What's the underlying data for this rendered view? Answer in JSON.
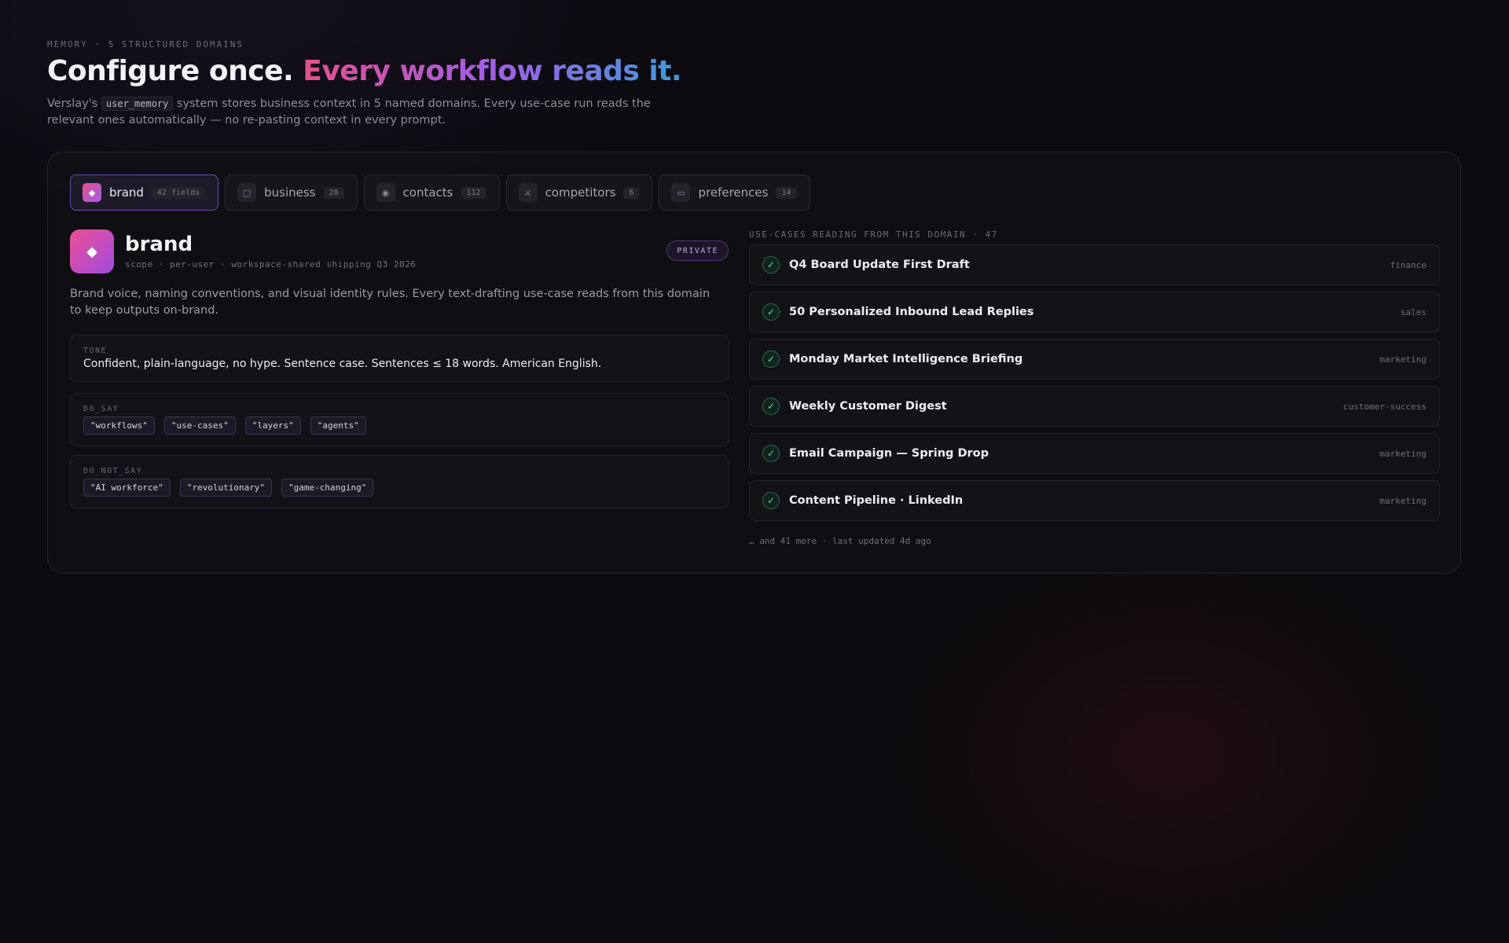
{
  "header": {
    "eyebrow": "MEMORY · 5 STRUCTURED DOMAINS",
    "title_plain": "Configure once.",
    "title_gradient": "Every workflow reads it.",
    "subtitle_before": "Verslay's",
    "subtitle_code": "user_memory",
    "subtitle_after": "system stores business context in 5 named domains. Every use-case run reads the relevant ones automatically — no re-pasting context in every prompt."
  },
  "tabs": [
    {
      "label": "brand",
      "count": "42 fields",
      "icon": "diamond-icon",
      "glyph": "◆",
      "active": true
    },
    {
      "label": "business",
      "count": "28",
      "icon": "square-icon",
      "glyph": "□",
      "active": false
    },
    {
      "label": "contacts",
      "count": "112",
      "icon": "circle-icon",
      "glyph": "◉",
      "active": false
    },
    {
      "label": "competitors",
      "count": "6",
      "icon": "swords-icon",
      "glyph": "⚔",
      "active": false
    },
    {
      "label": "preferences",
      "count": "14",
      "icon": "rectangle-icon",
      "glyph": "▭",
      "active": false
    }
  ],
  "domain": {
    "icon": "diamond-icon",
    "glyph": "◆",
    "title": "brand",
    "scope": "scope · per-user · workspace-shared shipping Q3 2026",
    "badge": "PRIVATE",
    "description": "Brand voice, naming conventions, and visual identity rules. Every text-drafting use-case reads from this domain to keep outputs on-brand.",
    "fields": {
      "tone": {
        "label": "TONE",
        "value": "Confident, plain-language, no hype. Sentence case. Sentences ≤ 18 words. American English."
      },
      "do_say": {
        "label": "DO_SAY",
        "chips": [
          "\"workflows\"",
          "\"use-cases\"",
          "\"layers\"",
          "\"agents\""
        ]
      },
      "do_not_say": {
        "label": "DO_NOT_SAY",
        "chips": [
          "\"AI workforce\"",
          "\"revolutionary\"",
          "\"game-changing\""
        ]
      }
    }
  },
  "use_cases": {
    "heading": "USE-CASES READING FROM THIS DOMAIN · 47",
    "check_glyph": "✓",
    "items": [
      {
        "title": "Q4 Board Update First Draft",
        "tag": "finance"
      },
      {
        "title": "50 Personalized Inbound Lead Replies",
        "tag": "sales"
      },
      {
        "title": "Monday Market Intelligence Briefing",
        "tag": "marketing"
      },
      {
        "title": "Weekly Customer Digest",
        "tag": "customer-success"
      },
      {
        "title": "Email Campaign — Spring Drop",
        "tag": "marketing"
      },
      {
        "title": "Content Pipeline · LinkedIn",
        "tag": "marketing"
      }
    ],
    "footer": "… and 41 more · last updated 4d ago"
  }
}
